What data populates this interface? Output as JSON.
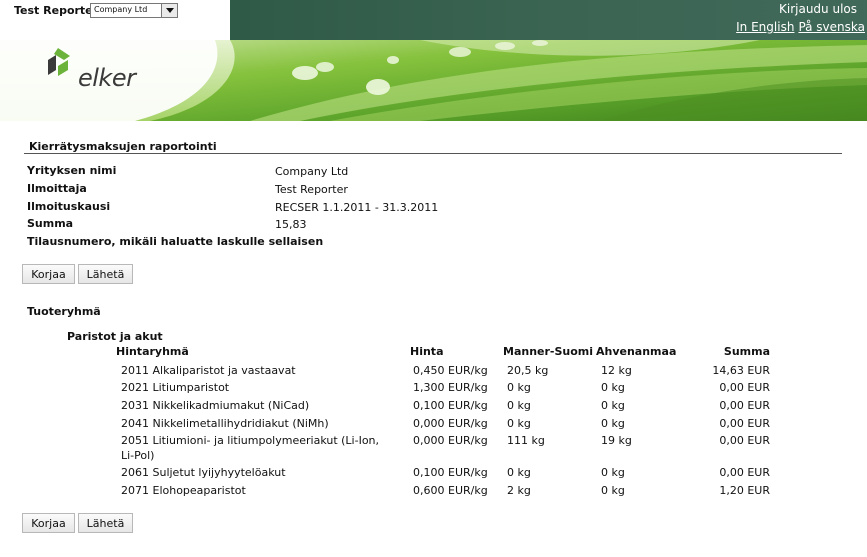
{
  "header": {
    "reporter_label": "Test Reporter -",
    "company_select_value": "Company Ltd",
    "logout_label": "Kirjaudu ulos",
    "lang_english": "In English",
    "lang_swedish": "På svenska"
  },
  "banner": {
    "logo_text": "elker"
  },
  "report": {
    "title": "Kierrätysmaksujen raportointi",
    "fields": [
      {
        "label": "Yrityksen nimi",
        "value": "Company Ltd"
      },
      {
        "label": "Ilmoittaja",
        "value": "Test Reporter"
      },
      {
        "label": "Ilmoituskausi",
        "value": "RECSER 1.1.2011 - 31.3.2011"
      },
      {
        "label": "Summa",
        "value": "15,83"
      },
      {
        "label": "Tilausnumero, mikäli haluatte laskulle sellaisen",
        "value": ""
      }
    ]
  },
  "buttons": {
    "fix_label": "Korjaa",
    "send_label": "Lähetä"
  },
  "products": {
    "section_label": "Tuoteryhmä",
    "group_label": "Paristot ja akut",
    "columns": {
      "name": "Hintaryhmä",
      "price": "Hinta",
      "mainland": "Manner-Suomi",
      "aland": "Ahvenanmaa",
      "sum": "Summa"
    },
    "rows": [
      {
        "name": "2011 Alkaliparistot ja vastaavat",
        "price": "0,450 EUR/kg",
        "mainland": "20,5 kg",
        "aland": "12 kg",
        "sum": "14,63 EUR"
      },
      {
        "name": "2021 Litiumparistot",
        "price": "1,300 EUR/kg",
        "mainland": "0 kg",
        "aland": "0 kg",
        "sum": "0,00 EUR"
      },
      {
        "name": "2031 Nikkelikadmiumakut (NiCad)",
        "price": "0,100 EUR/kg",
        "mainland": "0 kg",
        "aland": "0 kg",
        "sum": "0,00 EUR"
      },
      {
        "name": "2041 Nikkelimetallihydridiakut (NiMh)",
        "price": "0,000 EUR/kg",
        "mainland": "0 kg",
        "aland": "0 kg",
        "sum": "0,00 EUR"
      },
      {
        "name": "2051 Litiumioni- ja litiumpolymeeriakut (Li-Ion, Li-Pol)",
        "price": "0,000 EUR/kg",
        "mainland": "111 kg",
        "aland": "19 kg",
        "sum": "0,00 EUR"
      },
      {
        "name": "2061 Suljetut lyijyhyytelöakut",
        "price": "0,100 EUR/kg",
        "mainland": "0 kg",
        "aland": "0 kg",
        "sum": "0,00 EUR"
      },
      {
        "name": "2071 Elohopeaparistot",
        "price": "0,600 EUR/kg",
        "mainland": "2 kg",
        "aland": "0 kg",
        "sum": "1,20 EUR"
      }
    ]
  }
}
